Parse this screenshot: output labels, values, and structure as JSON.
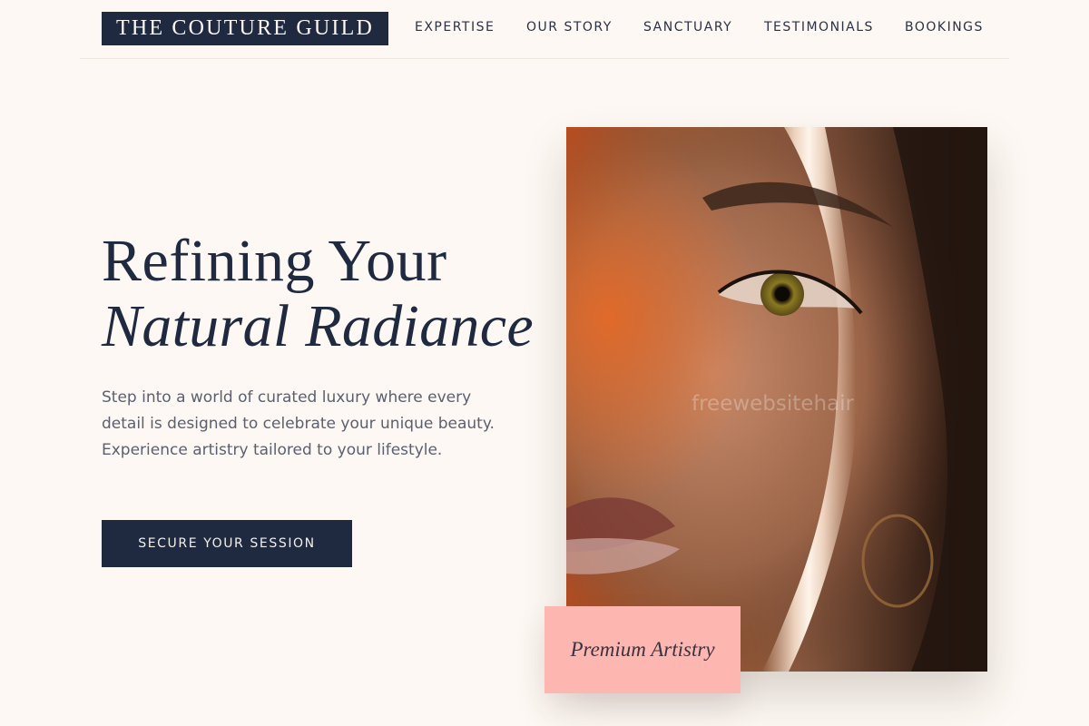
{
  "brand": {
    "name": "THE COUTURE GUILD"
  },
  "nav": {
    "items": [
      {
        "label": "EXPERTISE"
      },
      {
        "label": "OUR STORY"
      },
      {
        "label": "SANCTUARY"
      },
      {
        "label": "TESTIMONIALS"
      },
      {
        "label": "BOOKINGS"
      }
    ]
  },
  "hero": {
    "title_line1": "Refining Your",
    "title_line2": "Natural Radiance",
    "description": "Step into a world of curated luxury where every detail is designed to celebrate your unique beauty. Experience artistry tailored to your lifestyle.",
    "cta_label": "SECURE YOUR SESSION",
    "image_watermark": "freewebsitehair",
    "badge_label": "Premium Artistry"
  },
  "colors": {
    "background": "#fdf8f3",
    "navy": "#1f2940",
    "badge_pink": "#fdb6b0",
    "body_text": "#5b6070"
  }
}
